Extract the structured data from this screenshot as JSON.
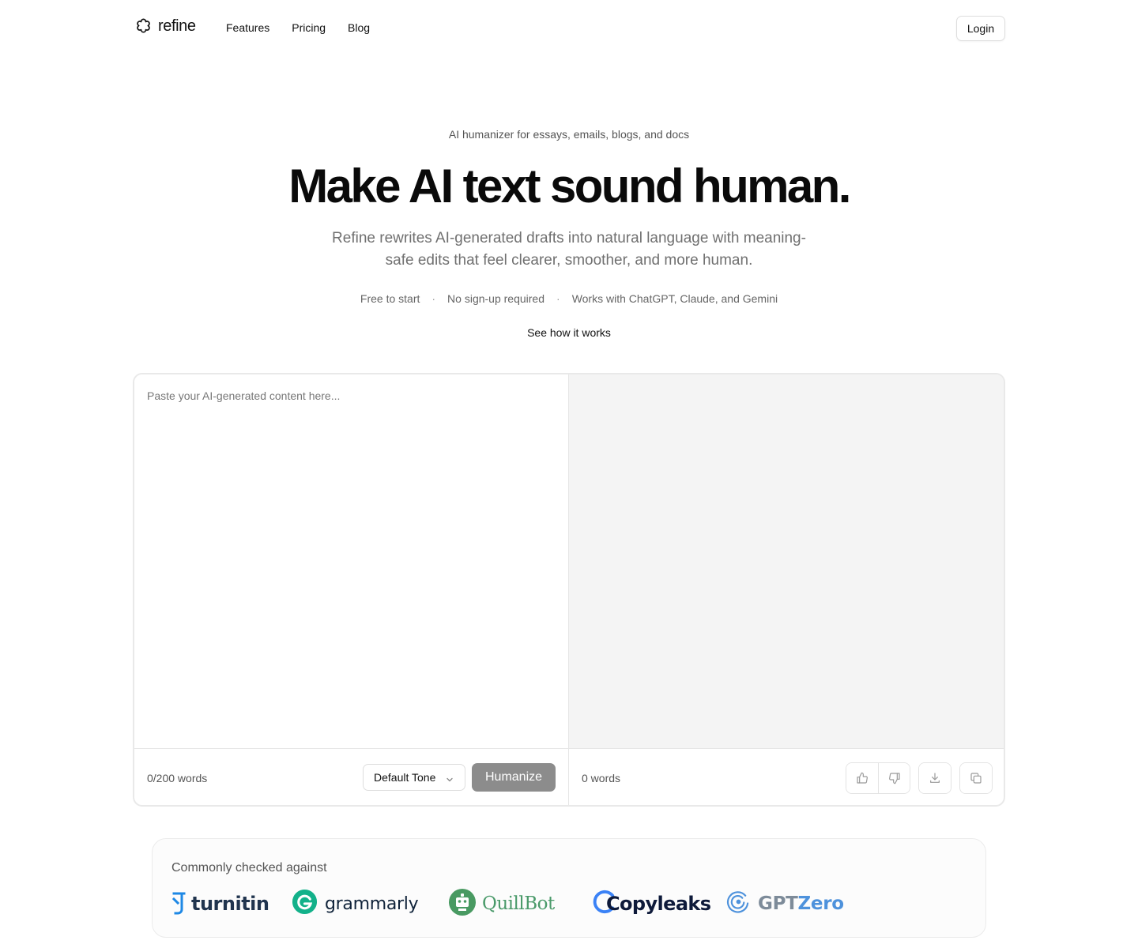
{
  "header": {
    "logo_text": "refine",
    "nav": [
      "Features",
      "Pricing",
      "Blog"
    ],
    "login_label": "Login"
  },
  "hero": {
    "eyebrow": "AI humanizer for essays, emails, blogs, and docs",
    "title": "Make AI text sound human.",
    "subtitle": "Refine rewrites AI-generated drafts into natural language with meaning-safe edits that feel clearer, smoother, and more human.",
    "bullets": [
      "Free to start",
      "No sign-up required",
      "Works with ChatGPT, Claude, and Gemini"
    ],
    "bullet_separator": "·",
    "cta_link": "See how it works"
  },
  "editor": {
    "input_placeholder": "Paste your AI-generated content here...",
    "input_value": "",
    "input_count": "0/200 words",
    "tone_selected": "Default Tone",
    "humanize_label": "Humanize",
    "output_count": "0 words",
    "output_actions": [
      "thumbs-up-icon",
      "thumbs-down-icon",
      "download-icon",
      "copy-icon"
    ]
  },
  "checked": {
    "title": "Commonly checked against",
    "brands": [
      {
        "name": "turnitin",
        "color": "#20344e",
        "accent": "#1e88e5"
      },
      {
        "name": "grammarly",
        "color": "#10233a",
        "accent": "#15c39a"
      },
      {
        "name": "QuillBot",
        "color": "#4a9a6a",
        "accent": "#499a62"
      },
      {
        "name": "Copyleaks",
        "color": "#0e1a3a",
        "accent": "#3b82f6"
      },
      {
        "name_part1": "GPT",
        "name_part2": "Zero",
        "color": "#7d8b99",
        "accent": "#4e92dc"
      }
    ]
  },
  "colors": {
    "text": "#111111",
    "muted": "#707070",
    "button_disabled": "#8c8c8c",
    "output_bg": "#f4f4f4"
  }
}
